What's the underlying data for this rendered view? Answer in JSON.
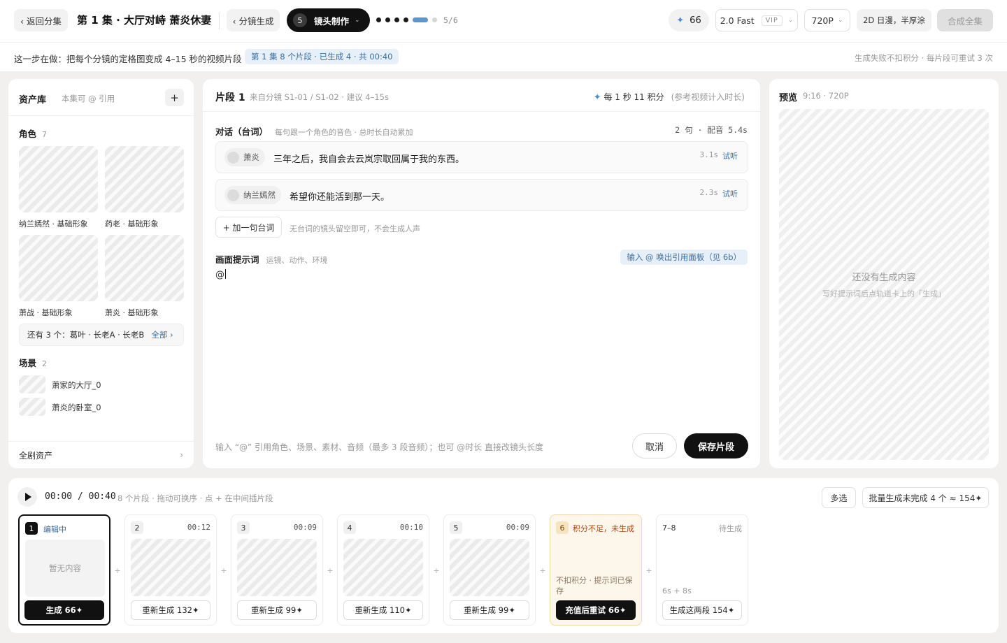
{
  "topbar": {
    "back_label": "‹ 返回分集",
    "episode_title": "第 1 集 · 大厅对峙 萧炎休妻",
    "storyboard_label": "‹ 分镜生成",
    "step": {
      "number": "5",
      "label": "镜头制作",
      "chevron": "⌄"
    },
    "progress": {
      "done_steps": 4,
      "current_step": 5,
      "total_steps": 6,
      "text": "5/6"
    },
    "credits": "66",
    "model": {
      "label": "2.0 Fast",
      "badge": "VIP"
    },
    "resolution": "720P",
    "style": "2D 日漫，半厚涂",
    "compose_label": "合成全集"
  },
  "subbar": {
    "text": "这一步在做：把每个分镜的定格图变成 4–15 秒的视频片段",
    "tag": "第 1 集 8 个片段 · 已生成 4 · 共 00:40",
    "right": "生成失败不扣积分 · 每片段可重试 3 次"
  },
  "assets": {
    "title": "资产库",
    "subtitle": "本集可 @ 引用",
    "add": "+",
    "characters_title": "角色",
    "characters_count": "7",
    "characters": [
      {
        "name": "纳兰嫣然 · 基础形象"
      },
      {
        "name": "药老 · 基础形象"
      },
      {
        "name": "萧战 · 基础形象"
      },
      {
        "name": "萧炎 · 基础形象"
      }
    ],
    "more_text": "还有 3 个：葛叶 · 长老A · 长老B",
    "more_link": "全部 ›",
    "scenes_title": "场景",
    "scenes_count": "2",
    "scenes": [
      {
        "name": "萧家的大厅_0"
      },
      {
        "name": "萧炎的卧室_0"
      }
    ],
    "all_label": "全剧资产",
    "all_arrow": "›"
  },
  "editor": {
    "title": "片段 1",
    "source": "来自分镜 S1-01 / S1-02 · 建议 4–15s",
    "rate": "每 1 秒 11 积分",
    "rate_note": "(参考视频计入时长)",
    "dialog_title": "对话（台词）",
    "dialog_sub": "每句跟一个角色的音色 · 总时长自动累加",
    "dialog_stat": "2 句 · 配音 5.4s",
    "lines": [
      {
        "speaker": "萧炎",
        "text": "三年之后，我自会去云岚宗取回属于我的东西。",
        "duration": "3.1s",
        "listen": "试听"
      },
      {
        "speaker": "纳兰嫣然",
        "text": "希望你还能活到那一天。",
        "duration": "2.3s",
        "listen": "试听"
      }
    ],
    "add_line": "+ 加一句台词",
    "add_line_hint": "无台词的镜头留空即可，不会生成人声",
    "prompt_title": "画面提示词",
    "prompt_sub": "运镜、动作、环境",
    "prompt_hint": "输入 @ 唤出引用面板（见 6b）",
    "prompt_value": "@",
    "footer_hint": "输入 “@” 引用角色、场景、素材、音频（最多 3 段音频）；也可 @时长 直接改镜头长度",
    "cancel": "取消",
    "save": "保存片段"
  },
  "preview": {
    "title": "预览",
    "meta": "9:16 · 720P",
    "empty": "还没有生成内容",
    "empty_sub": "写好提示词后点轨道卡上的「生成」"
  },
  "timeline": {
    "time": "00:00 / 00:40",
    "meta": "8 个片段 · 拖动可换序 · 点 + 在中间插片段",
    "multi": "多选",
    "batch": "批量生成未完成 4 个 ≈ 154✦",
    "gap": "+",
    "clips": [
      {
        "num": "1",
        "status": "编辑中",
        "empty": "暂无内容",
        "button": "生成 66✦"
      },
      {
        "num": "2",
        "duration": "00:12",
        "button": "重新生成 132✦"
      },
      {
        "num": "3",
        "duration": "00:09",
        "button": "重新生成 99✦"
      },
      {
        "num": "4",
        "duration": "00:10",
        "button": "重新生成 110✦"
      },
      {
        "num": "5",
        "duration": "00:09",
        "button": "重新生成 99✦"
      },
      {
        "num": "6",
        "status": "积分不足，未生成",
        "note": "不扣积分 · 提示词已保存",
        "button": "充值后重试 66✦"
      },
      {
        "num": "7–8",
        "pending": "待生成",
        "sizes": "6s + 8s",
        "button": "生成这两段 154✦"
      }
    ]
  },
  "colors": {
    "accent_blue": "#3b6ea0",
    "progress_blue": "#5b96cf",
    "warning_bg": "#fdf6ea",
    "primary_dark": "#111111"
  },
  "icons": {
    "credits": "sparkle-icon",
    "play": "play-icon",
    "chevron": "chevron-down-icon"
  }
}
